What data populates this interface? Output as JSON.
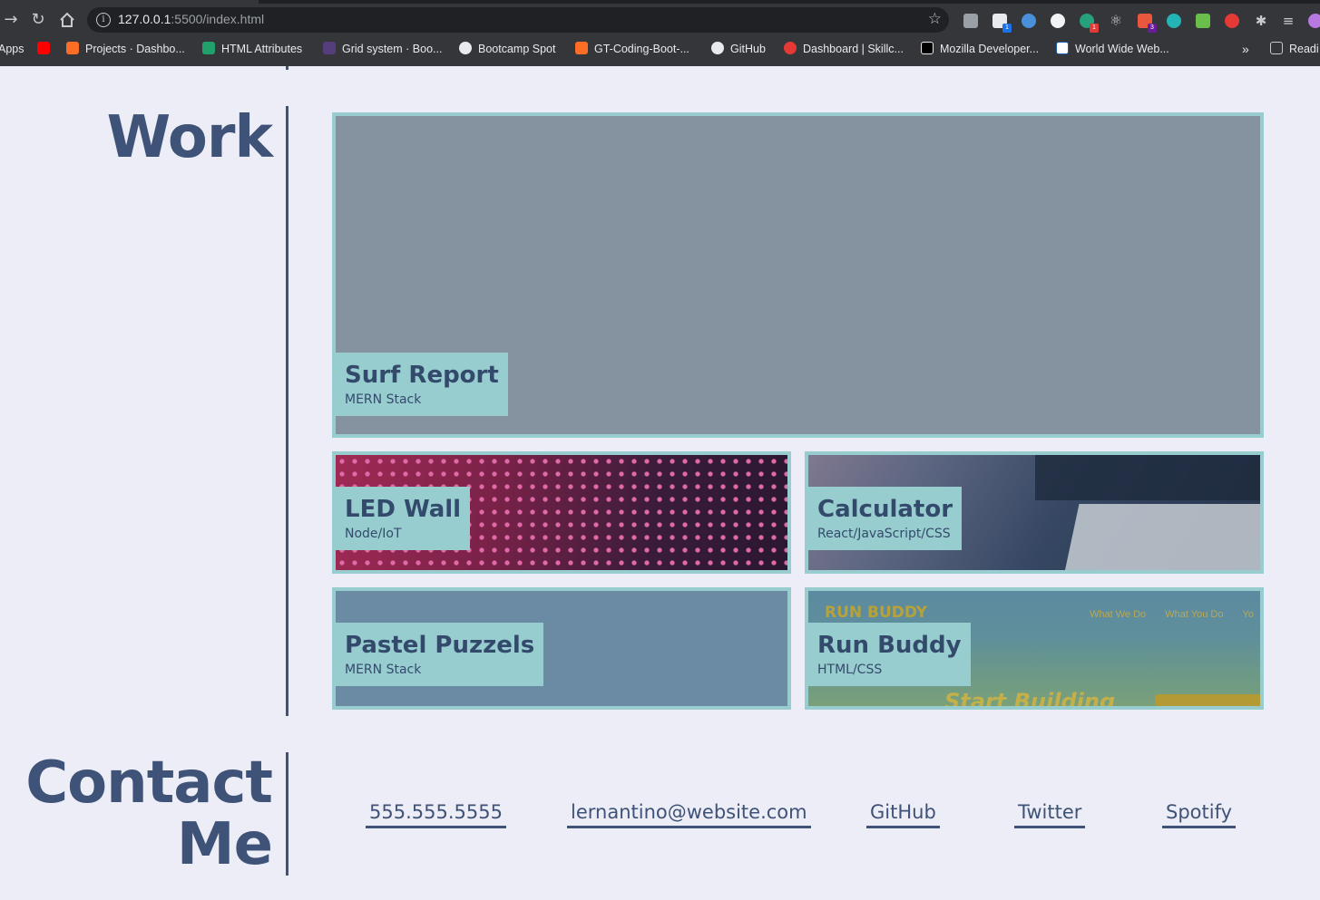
{
  "browser": {
    "url_host": "127.0.0.1",
    "url_rest": ":5500/index.html",
    "bookmarks": [
      "Apps",
      "Projects · Dashbo...",
      "HTML Attributes",
      "Grid system · Boo...",
      "Bootcamp Spot",
      "GT-Coding-Boot-...",
      "GitHub",
      "Dashboard | Skillc...",
      "Mozilla Developer...",
      "World Wide Web...",
      "Readi"
    ],
    "more_bookmarks": "»",
    "extension_badges": [
      "1",
      "1",
      "3"
    ]
  },
  "work": {
    "title": "Work",
    "projects": [
      {
        "name": "Surf Report",
        "stack": "MERN Stack"
      },
      {
        "name": "LED Wall",
        "stack": "Node/IoT"
      },
      {
        "name": "Calculator",
        "stack": "React/JavaScript/CSS"
      },
      {
        "name": "Pastel Puzzels",
        "stack": "MERN Stack"
      },
      {
        "name": "Run Buddy",
        "stack": "HTML/CSS"
      }
    ],
    "run_buddy_preview": {
      "logo": "RUN BUDDY",
      "nav": [
        "What We Do",
        "What You Do",
        "Yo"
      ],
      "hero": "Start Building"
    }
  },
  "contact": {
    "title_line1": "Contact",
    "title_line2": "Me",
    "links": [
      "555.555.5555",
      "lernantino@website.com",
      "GitHub",
      "Twitter",
      "Spotify"
    ]
  },
  "colors": {
    "page_bg": "#ecedf6",
    "accent": "#3e5377",
    "card_border": "#97cdcf"
  }
}
